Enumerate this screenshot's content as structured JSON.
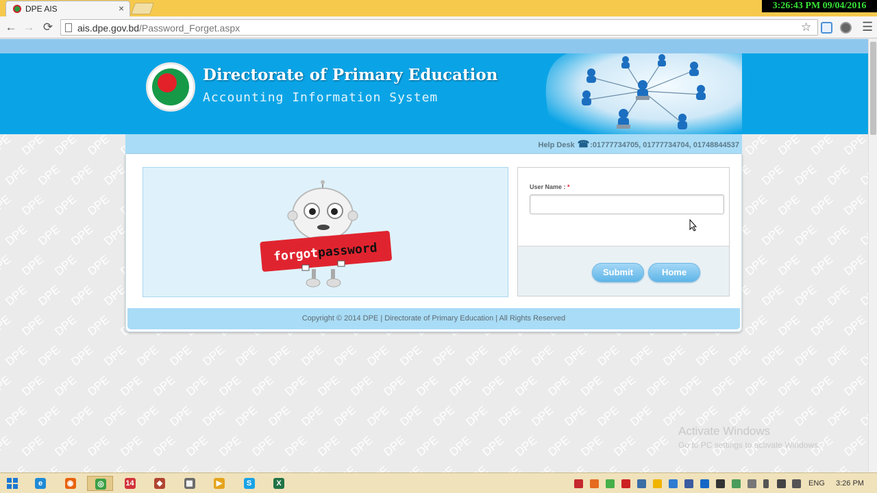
{
  "browser": {
    "tab_title": "DPE AIS",
    "tab_close": "×",
    "url_host": "ais.dpe.gov.bd",
    "url_path": "/Password_Forget.aspx",
    "back": "←",
    "forward": "→",
    "reload": "⟳",
    "star": "☆",
    "menu": "☰",
    "clock_overlay": "3:26:43 PM 09/04/2016"
  },
  "header": {
    "title": "Directorate of Primary Education",
    "subtitle": "Accounting Information System"
  },
  "helpdesk": {
    "label": "Help Desk",
    "icon": "☎",
    "phones": ":01777734705, 01777734704, 01748844537"
  },
  "form": {
    "username_label": "User Name :",
    "required_mark": "*",
    "username_value": "",
    "submit_label": "Submit",
    "home_label": "Home"
  },
  "illustration": {
    "sign_text_1": "forgot",
    "sign_text_2": "password"
  },
  "footer": {
    "copyright": "Copyright © 2014 DPE | Directorate of Primary Education | All Rights Reserved"
  },
  "watermark_text": "DPE",
  "activate": {
    "title": "Activate Windows",
    "subtitle": "Go to PC settings to activate Windows."
  },
  "taskbar": {
    "apps": [
      {
        "icon": "ie-icon",
        "glyph": "e",
        "color": "#1f8ad6"
      },
      {
        "icon": "firefox-icon",
        "glyph": "◉",
        "color": "#e8620f"
      },
      {
        "icon": "chrome-icon",
        "glyph": "◎",
        "color": "#3aa046",
        "active": true
      },
      {
        "icon": "app-14-icon",
        "glyph": "14",
        "color": "#d2333a"
      },
      {
        "icon": "app-icon",
        "glyph": "◆",
        "color": "#b14432"
      },
      {
        "icon": "calculator-icon",
        "glyph": "▦",
        "color": "#6c6c6c"
      },
      {
        "icon": "media-icon",
        "glyph": "▶",
        "color": "#e5a41d"
      },
      {
        "icon": "skype-icon",
        "glyph": "S",
        "color": "#19a3e6"
      },
      {
        "icon": "excel-icon",
        "glyph": "X",
        "color": "#217346"
      }
    ],
    "language": "ENG",
    "time": "3:26 PM"
  }
}
